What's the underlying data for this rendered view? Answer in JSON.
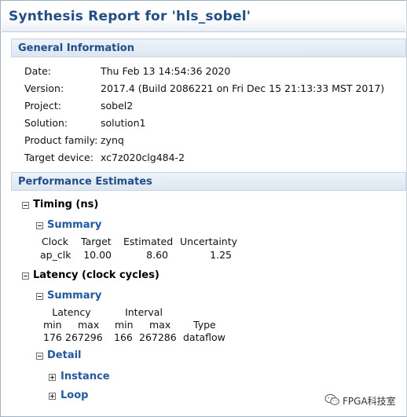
{
  "report": {
    "title": "Synthesis Report for 'hls_sobel'"
  },
  "general_information": {
    "header": "General Information",
    "fields": [
      {
        "label": "Date:",
        "value": "Thu Feb 13 14:54:36 2020"
      },
      {
        "label": "Version:",
        "value": "2017.4 (Build 2086221 on Fri Dec 15 21:13:33 MST 2017)"
      },
      {
        "label": "Project:",
        "value": "sobel2"
      },
      {
        "label": "Solution:",
        "value": "solution1"
      },
      {
        "label": "Product family:",
        "value": "zynq"
      },
      {
        "label": "Target device:",
        "value": "xc7z020clg484-2"
      }
    ]
  },
  "performance_estimates": {
    "header": "Performance Estimates",
    "timing": {
      "label": "Timing (ns)",
      "summary_label": "Summary",
      "columns": [
        "Clock",
        "Target",
        "Estimated",
        "Uncertainty"
      ],
      "rows": [
        [
          "ap_clk",
          "10.00",
          "8.60",
          "1.25"
        ]
      ]
    },
    "latency": {
      "label": "Latency (clock cycles)",
      "summary_label": "Summary",
      "group_headers": [
        "Latency",
        "Interval"
      ],
      "columns": [
        "min",
        "max",
        "min",
        "max",
        "Type"
      ],
      "rows": [
        [
          "176",
          "267296",
          "166",
          "267286",
          "dataflow"
        ]
      ],
      "detail": {
        "label": "Detail",
        "children": [
          "Instance",
          "Loop"
        ]
      }
    }
  },
  "watermark": {
    "text": "FPGA科技室",
    "icon": "wechat-icon"
  },
  "colors": {
    "title_blue": "#1f4e8a",
    "link_blue": "#1f5aa6",
    "header_bg": "#dde6f1"
  }
}
